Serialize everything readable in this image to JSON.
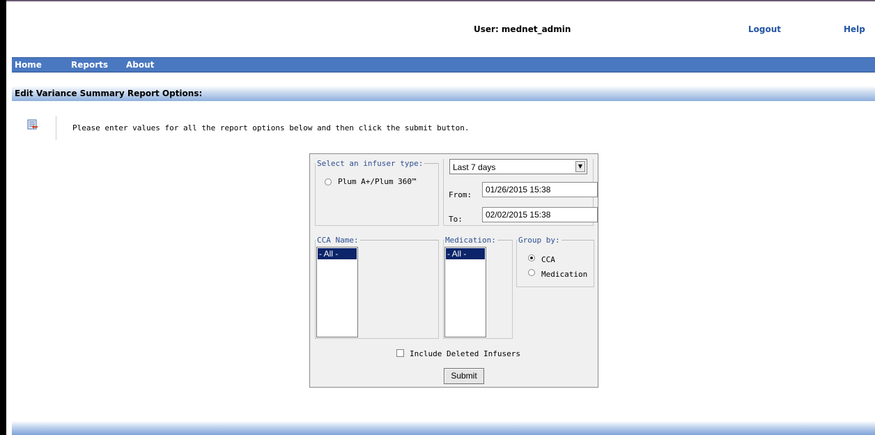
{
  "header": {
    "user_label": "User: mednet_admin",
    "logout": "Logout",
    "help": "Help"
  },
  "nav": {
    "items": [
      "Home",
      "Reports",
      "About"
    ]
  },
  "section": {
    "title": "Edit Variance Summary Report Options:"
  },
  "instructions": "Please enter values for all the report options below and then click the submit button.",
  "form": {
    "infuser_legend": "Select an infuser type:",
    "infuser_option": "Plum A+/Plum 360™",
    "date_range": {
      "selected": "Last 7 days",
      "from_label": "From:",
      "from_value": "01/26/2015 15:38",
      "to_label": "To:",
      "to_value": "02/02/2015 15:38"
    },
    "cca_legend": "CCA Name:",
    "cca_selected": "- All -",
    "medication_legend": "Medication:",
    "medication_selected": "- All -",
    "groupby_legend": "Group by:",
    "groupby_options": [
      "CCA",
      "Medication"
    ],
    "groupby_selected": "CCA",
    "include_deleted_label": "Include Deleted Infusers",
    "submit_label": "Submit"
  },
  "colors": {
    "nav_bg": "#4a78c0",
    "legend_text": "#2e4f93",
    "link": "#2255a4",
    "list_selected": "#0b246a"
  }
}
